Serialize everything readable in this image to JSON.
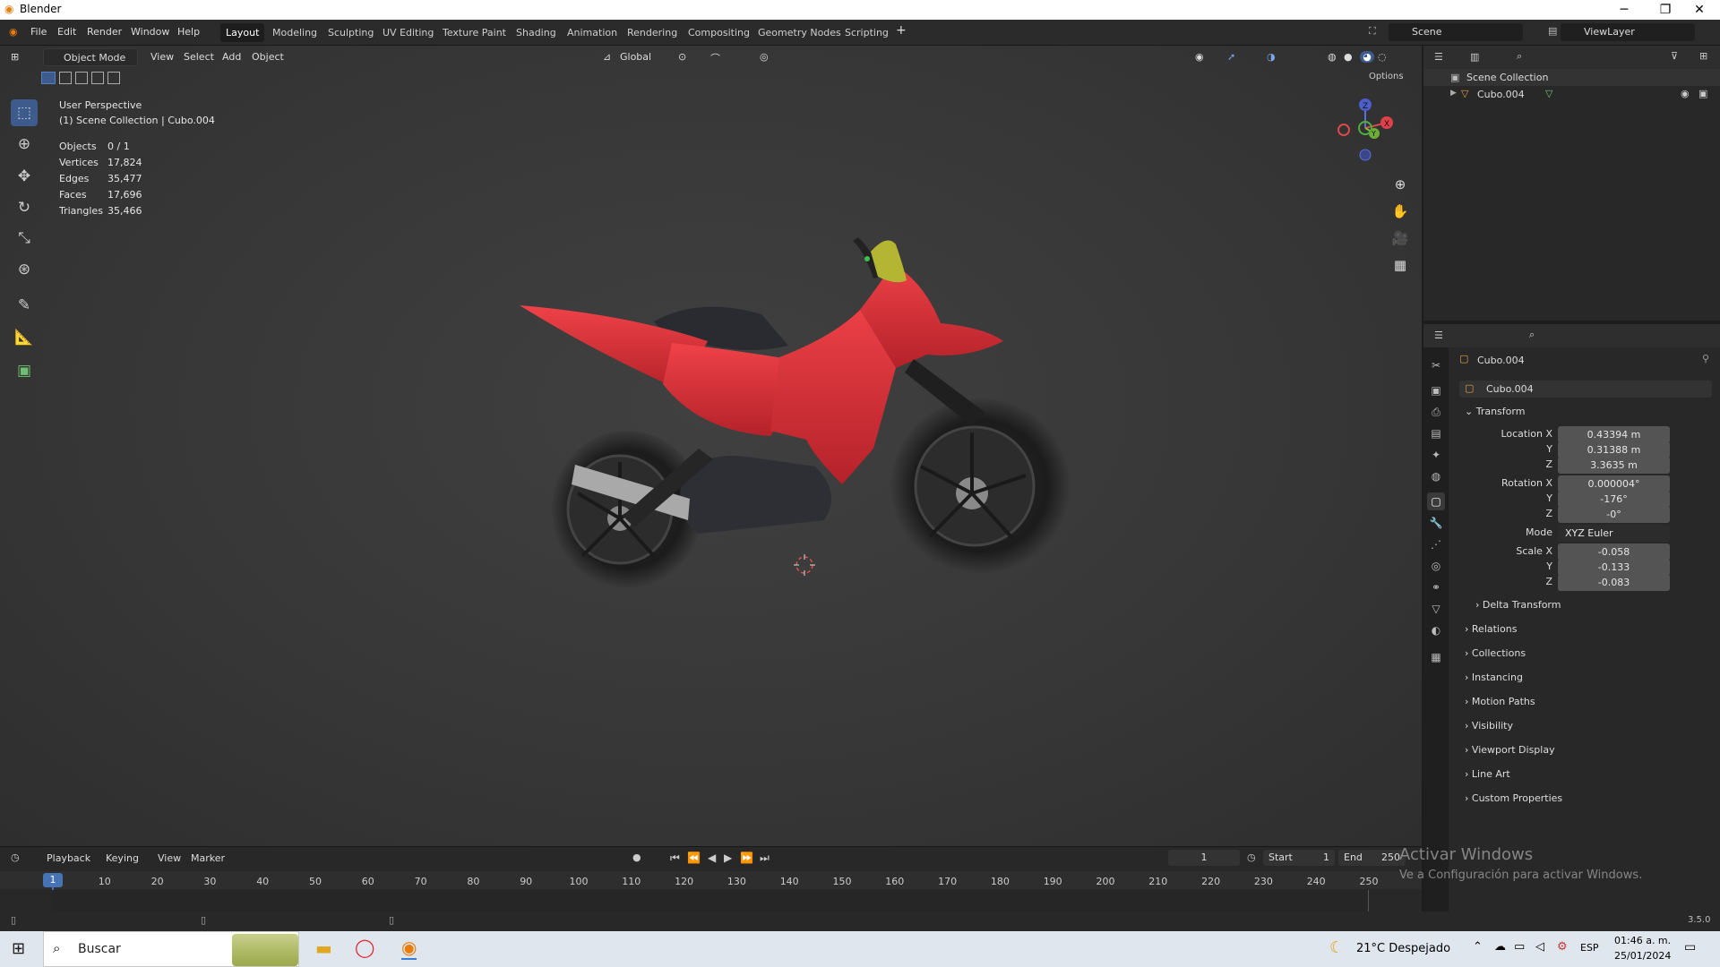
{
  "window": {
    "title": "Blender"
  },
  "menu": [
    "Edit",
    "Render",
    "Window",
    "Help"
  ],
  "file_label": "File",
  "workspaces": [
    "Layout",
    "Modeling",
    "Sculpting",
    "UV Editing",
    "Texture Paint",
    "Shading",
    "Animation",
    "Rendering",
    "Compositing",
    "Geometry Nodes",
    "Scripting"
  ],
  "scene_selector": "Scene",
  "viewlayer_selector": "ViewLayer",
  "viewport": {
    "mode": "Object Mode",
    "menus": [
      "View",
      "Select",
      "Add",
      "Object"
    ],
    "transform_orientation": "Global",
    "options_label": "Options",
    "perspective": "User Perspective",
    "collection_info": "(1) Scene Collection | Cubo.004",
    "stats": [
      {
        "label": "Objects",
        "value": "0 / 1"
      },
      {
        "label": "Vertices",
        "value": "17,824"
      },
      {
        "label": "Edges",
        "value": "35,477"
      },
      {
        "label": "Faces",
        "value": "17,696"
      },
      {
        "label": "Triangles",
        "value": "35,466"
      }
    ],
    "gizmo": {
      "x": "X",
      "y": "Y",
      "z": "Z"
    }
  },
  "outliner": {
    "root": "Scene Collection",
    "items": [
      "Cubo.004"
    ]
  },
  "properties": {
    "object_name": "Cubo.004",
    "data_name": "Cubo.004",
    "transform_label": "Transform",
    "location": {
      "label": "Location X",
      "x": "0.43394 m",
      "y": "0.31388 m",
      "z": "3.3635 m"
    },
    "rotation": {
      "label": "Rotation X",
      "x": "0.000004°",
      "y": "-176°",
      "z": "-0°"
    },
    "mode": {
      "label": "Mode",
      "value": "XYZ Euler"
    },
    "scale": {
      "label": "Scale X",
      "x": "-0.058",
      "y": "-0.133",
      "z": "-0.083"
    },
    "axis_y": "Y",
    "axis_z": "Z",
    "delta_transform": "Delta Transform",
    "panels": [
      "Relations",
      "Collections",
      "Instancing",
      "Motion Paths",
      "Visibility",
      "Viewport Display",
      "Line Art",
      "Custom Properties"
    ]
  },
  "timeline": {
    "menus": [
      "Playback",
      "Keying",
      "View",
      "Marker"
    ],
    "current_frame": "1",
    "start_label": "Start",
    "start": "1",
    "end_label": "End",
    "end": "250",
    "ticks": [
      "10",
      "20",
      "30",
      "40",
      "50",
      "60",
      "70",
      "80",
      "90",
      "100",
      "110",
      "120",
      "130",
      "140",
      "150",
      "160",
      "170",
      "180",
      "190",
      "200",
      "210",
      "220",
      "230",
      "240",
      "250"
    ],
    "playhead": "1"
  },
  "status": {
    "version": "3.5.0"
  },
  "watermark": {
    "title": "Activar Windows",
    "subtitle": "Ve a Configuración para activar Windows."
  },
  "taskbar": {
    "search": "Buscar",
    "weather": "21°C  Despejado",
    "lang": "ESP",
    "time": "01:46 a. m.",
    "date": "25/01/2024"
  },
  "colors": {
    "accent": "#3d5b8c",
    "bike_red": "#d42f35",
    "timeline_active": "#4772b3"
  }
}
